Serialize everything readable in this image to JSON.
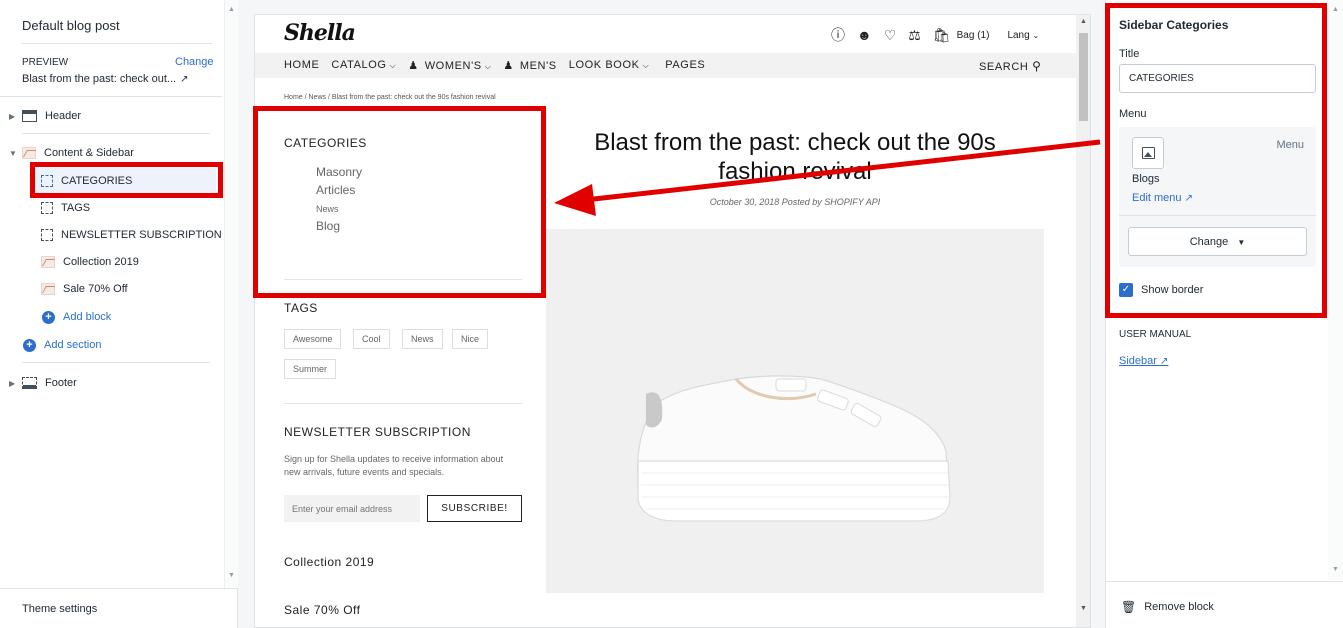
{
  "left": {
    "title": "Default blog post",
    "preview_label": "PREVIEW",
    "change_link": "Change",
    "preview_value": "Blast from the past: check out...",
    "tree": {
      "header": "Header",
      "content_sidebar": "Content & Sidebar",
      "blocks": [
        "CATEGORIES",
        "TAGS",
        "NEWSLETTER SUBSCRIPTION",
        "Collection 2019",
        "Sale 70% Off"
      ],
      "add_block": "Add block",
      "add_section": "Add section",
      "footer": "Footer"
    },
    "theme_settings": "Theme settings"
  },
  "store": {
    "logo": "Shella",
    "bag": "Bag (1)",
    "lang": "Lang",
    "nav": [
      "HOME",
      "CATALOG",
      "WOMEN'S",
      "MEN'S",
      "LOOK BOOK",
      "PAGES"
    ],
    "search": "SEARCH",
    "breadcrumb": "Home  /  News  /  Blast from the past: check out the 90s fashion revival",
    "categories": {
      "heading": "CATEGORIES",
      "links": [
        "Masonry",
        "Articles",
        "News",
        "Blog"
      ]
    },
    "tags": {
      "heading": "TAGS",
      "items": [
        "Awesome",
        "Cool",
        "News",
        "Nice",
        "Summer"
      ]
    },
    "newsletter": {
      "heading": "NEWSLETTER SUBSCRIPTION",
      "description": "Sign up for Shella updates to receive information about new arrivals, future events and specials.",
      "placeholder": "Enter your email address",
      "button": "SUBSCRIBE!"
    },
    "collection": "Collection 2019",
    "sale": "Sale 70% Off",
    "post": {
      "title": "Blast from the past: check out the 90s fashion revival",
      "meta": "October 30, 2018 Posted by SHOPIFY API"
    }
  },
  "right": {
    "title": "Sidebar Categories",
    "title_label": "Title",
    "title_value": "CATEGORIES",
    "menu_label": "Menu",
    "menu_tag": "Menu",
    "menu_name": "Blogs",
    "edit_menu": "Edit menu",
    "change_button": "Change",
    "show_border": "Show border",
    "show_border_checked": true,
    "user_manual": "USER MANUAL",
    "sidebar_link": "Sidebar",
    "remove_block": "Remove block"
  },
  "colors": {
    "accent": "#2c6ecb",
    "annotation": "#e10000"
  }
}
